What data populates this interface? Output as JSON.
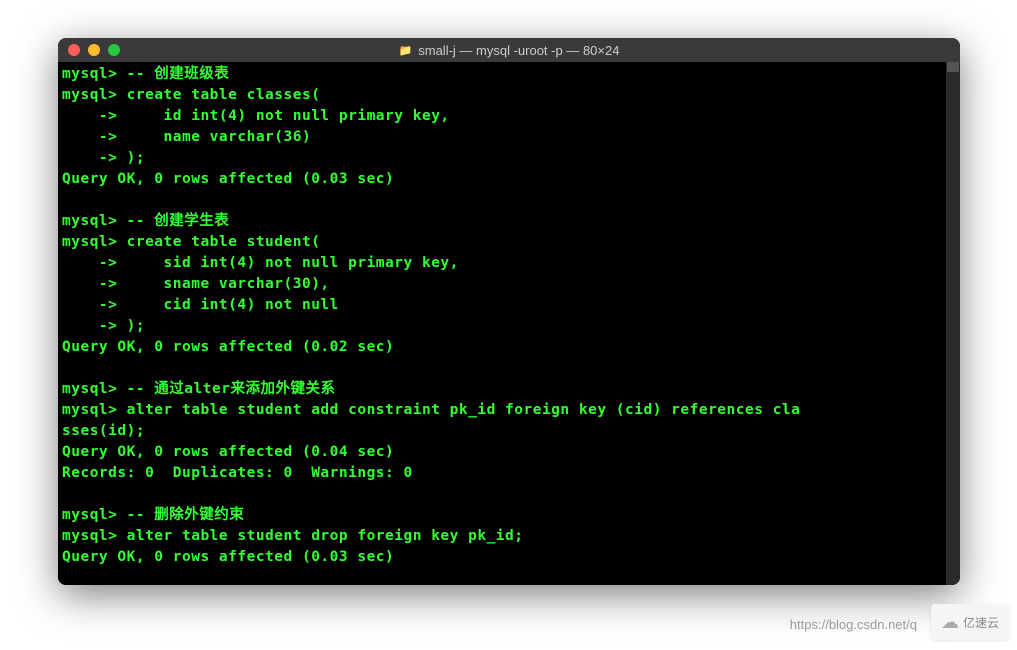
{
  "window": {
    "title": "small-j — mysql -uroot -p — 80×24"
  },
  "terminal": {
    "lines": [
      "mysql> -- 创建班级表",
      "mysql> create table classes(",
      "    ->     id int(4) not null primary key,",
      "    ->     name varchar(36)",
      "    -> );",
      "Query OK, 0 rows affected (0.03 sec)",
      "",
      "mysql> -- 创建学生表",
      "mysql> create table student(",
      "    ->     sid int(4) not null primary key,",
      "    ->     sname varchar(30),",
      "    ->     cid int(4) not null",
      "    -> );",
      "Query OK, 0 rows affected (0.02 sec)",
      "",
      "mysql> -- 通过alter来添加外键关系",
      "mysql> alter table student add constraint pk_id foreign key (cid) references cla",
      "sses(id);",
      "Query OK, 0 rows affected (0.04 sec)",
      "Records: 0  Duplicates: 0  Warnings: 0",
      "",
      "mysql> -- 删除外键约束",
      "mysql> alter table student drop foreign key pk_id;",
      "Query OK, 0 rows affected (0.03 sec)"
    ]
  },
  "watermark": {
    "url": "https://blog.csdn.net/q",
    "logo": "亿速云"
  }
}
